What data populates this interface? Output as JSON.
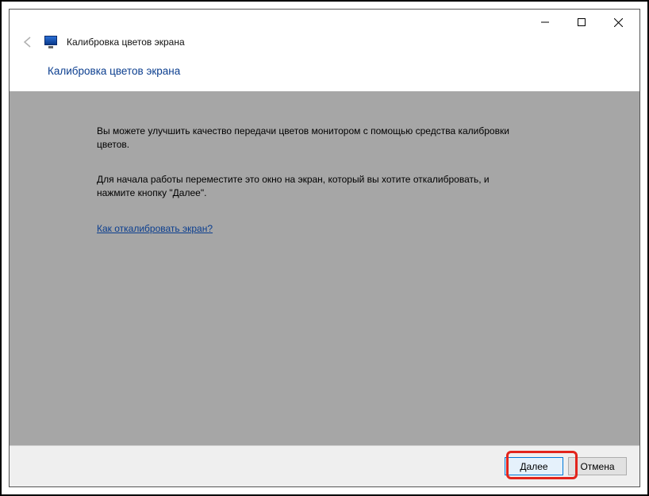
{
  "window": {
    "title": "Калибровка цветов экрана"
  },
  "heading": "Калибровка цветов экрана",
  "body": {
    "p1": "Вы можете улучшить качество передачи цветов монитором с помощью средства калибровки цветов.",
    "p2": "Для начала работы переместите это окно на экран, который вы хотите откалибровать, и нажмите кнопку \"Далее\".",
    "help_link": "Как откалибровать экран?"
  },
  "footer": {
    "next": "Далее",
    "cancel": "Отмена"
  }
}
